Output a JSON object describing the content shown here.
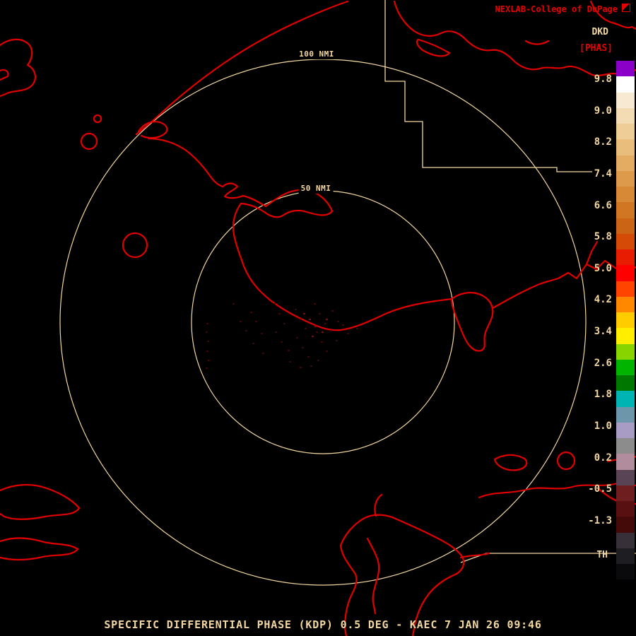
{
  "header": {
    "brand": "NEXLAB-College of DuPage",
    "product_code": "DKD",
    "product_phase": "[PHAS]"
  },
  "colorbar": {
    "tick_labels": [
      "9.8",
      "9.0",
      "8.2",
      "7.4",
      "6.6",
      "5.8",
      "5.0",
      "4.2",
      "3.4",
      "2.6",
      "1.8",
      "1.0",
      "0.2",
      "-0.5",
      "-1.3"
    ],
    "bottom_label": "TH",
    "colors": [
      "#8b00c8",
      "#ffffff",
      "#f8ead2",
      "#f3dcb4",
      "#eecd96",
      "#e9bd7c",
      "#e3ac62",
      "#dd9a4a",
      "#d78936",
      "#d17724",
      "#cb6414",
      "#d44a06",
      "#e81c00",
      "#ff0000",
      "#ff4400",
      "#ff8800",
      "#ffcc00",
      "#ffee00",
      "#88d400",
      "#00b400",
      "#007800",
      "#00b4b4",
      "#6e96aa",
      "#a89cc4",
      "#8c8c8c",
      "#b08c9c",
      "#584454",
      "#6e1e1e",
      "#581010",
      "#440a0a",
      "#383038",
      "#1e1e22",
      "#0a0a0c"
    ]
  },
  "range_rings": {
    "outer_label": "100 NMI",
    "inner_label": "50 NMI"
  },
  "footer": {
    "caption": "SPECIFIC DIFFERENTIAL PHASE (KDP) 0.5 DEG - KAEC 7 JAN 26 09:46"
  },
  "colors": {
    "background": "#000000",
    "map_outline": "#e00000",
    "boundary_wheat": "#f2d7a0",
    "text_red": "#e80000",
    "text_wheat": "#f2d7a0"
  }
}
